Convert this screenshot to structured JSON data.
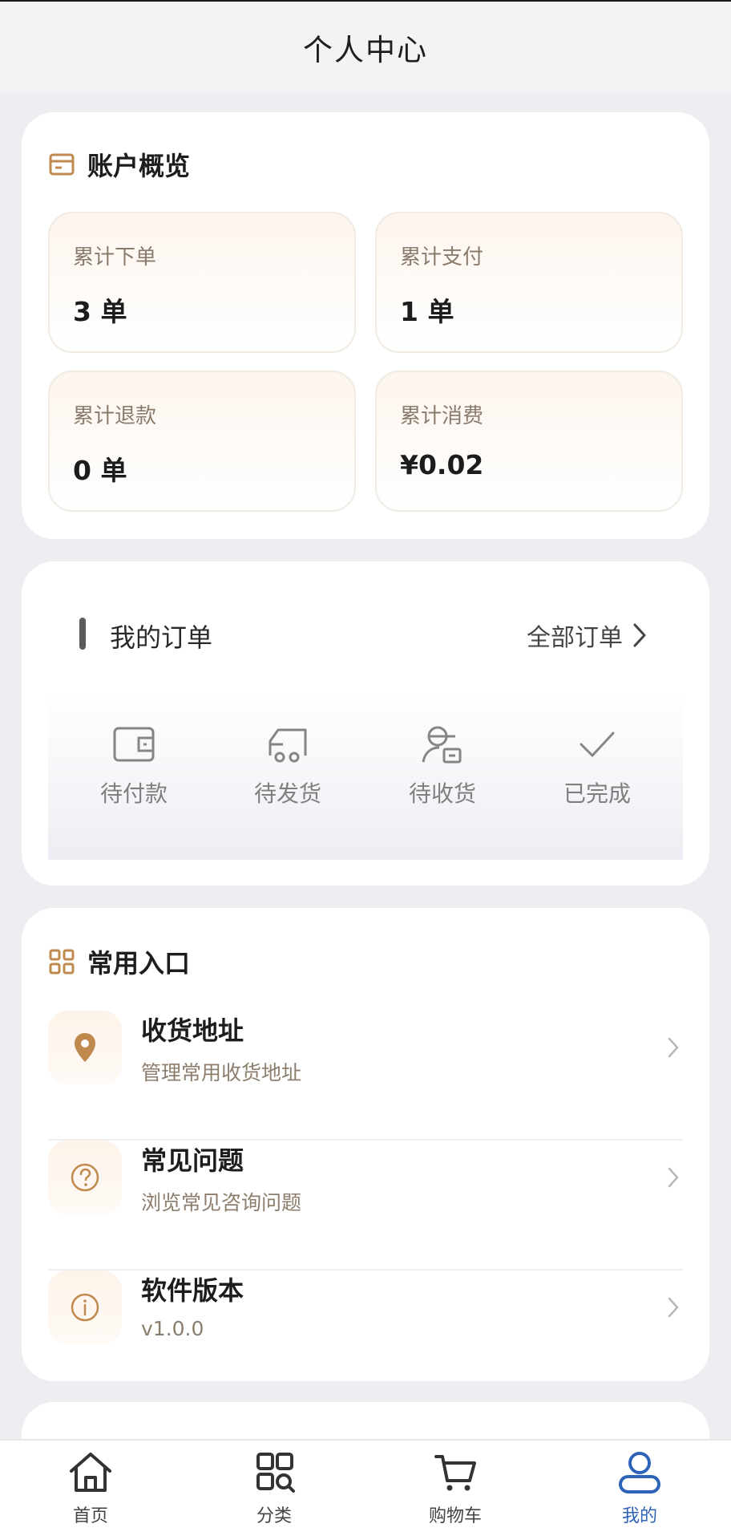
{
  "header": {
    "title": "个人中心"
  },
  "account": {
    "title": "账户概览",
    "stats": [
      {
        "label": "累计下单",
        "value": "3 单"
      },
      {
        "label": "累计支付",
        "value": "1 单"
      },
      {
        "label": "累计退款",
        "value": "0 单"
      },
      {
        "label": "累计消费",
        "value": "¥0.02"
      }
    ]
  },
  "orders": {
    "title": "我的订单",
    "all_label": "全部订单",
    "items": [
      {
        "label": "待付款",
        "icon": "wallet-icon"
      },
      {
        "label": "待发货",
        "icon": "truck-icon"
      },
      {
        "label": "待收货",
        "icon": "courier-icon"
      },
      {
        "label": "已完成",
        "icon": "check-icon"
      }
    ]
  },
  "common": {
    "title": "常用入口",
    "entries": [
      {
        "title": "收货地址",
        "subtitle": "管理常用收货地址",
        "icon": "location-pin-icon"
      },
      {
        "title": "常见问题",
        "subtitle": "浏览常见咨询问题",
        "icon": "question-circle-icon"
      },
      {
        "title": "软件版本",
        "subtitle": "v1.0.0",
        "icon": "info-circle-icon"
      }
    ]
  },
  "tabbar": {
    "active": "我的",
    "tabs": [
      {
        "label": "首页",
        "icon": "home-icon"
      },
      {
        "label": "分类",
        "icon": "category-search-icon"
      },
      {
        "label": "购物车",
        "icon": "cart-icon"
      },
      {
        "label": "我的",
        "icon": "user-icon"
      }
    ]
  },
  "colors": {
    "accent": "#c0894d",
    "active_tab": "#2e64b8"
  }
}
